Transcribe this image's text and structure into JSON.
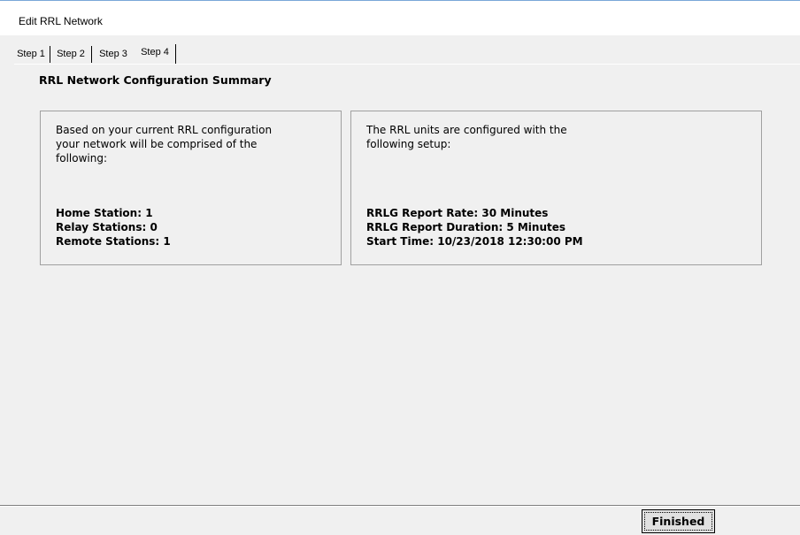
{
  "window": {
    "title": "Edit RRL Network"
  },
  "tabs": [
    {
      "label": "Step 1",
      "active": false
    },
    {
      "label": "Step 2",
      "active": false
    },
    {
      "label": "Step 3",
      "active": false
    },
    {
      "label": "Step 4",
      "active": true
    }
  ],
  "summary": {
    "heading": "RRL Network Configuration Summary",
    "network_box": {
      "intro": "Based on your current RRL configuration\nyour network will be comprised of the\nfollowing:",
      "home_stations": "Home Station: 1",
      "relay_stations": "Relay Stations: 0",
      "remote_stations": "Remote Stations: 1"
    },
    "units_box": {
      "intro": "The RRL units are configured with the\nfollowing setup:",
      "report_rate": "RRLG Report Rate: 30 Minutes",
      "report_duration": "RRLG Report Duration: 5 Minutes",
      "start_time": "Start Time: 10/23/2018 12:30:00 PM"
    }
  },
  "footer": {
    "finished_label": "Finished"
  },
  "colors": {
    "window_bg": "#f0f0f0",
    "box_border": "#a0a0a0",
    "title_bar_bg": "#ffffff"
  }
}
